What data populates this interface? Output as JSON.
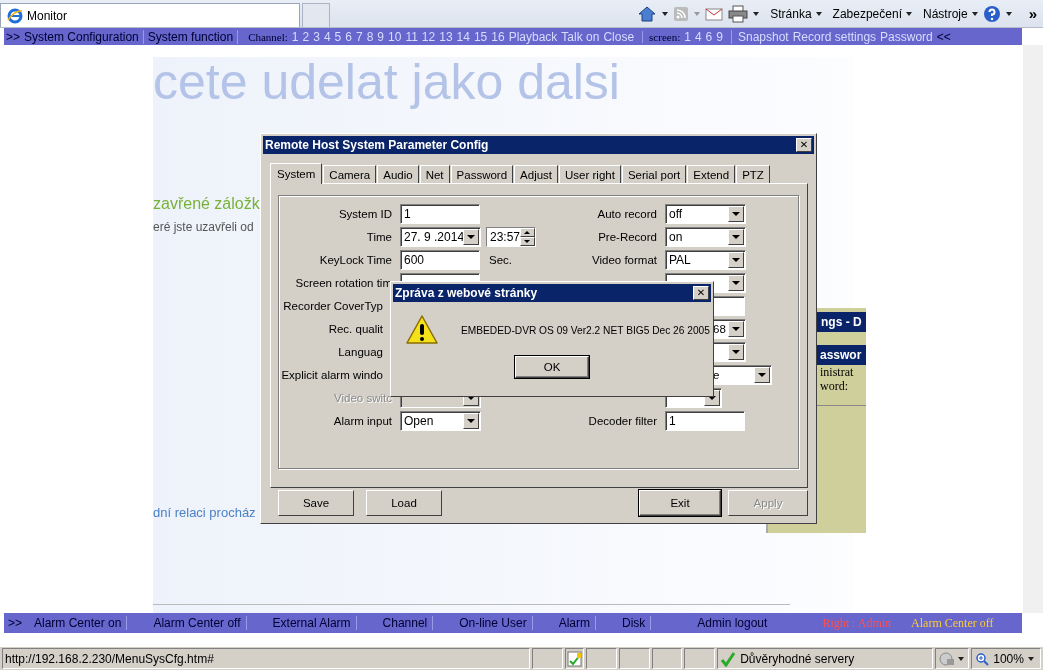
{
  "browser": {
    "tab_title": "Monitor",
    "menus": [
      "Stránka",
      "Zabezpečení",
      "Nástroje"
    ],
    "more": "»"
  },
  "nav": {
    "lead": ">>",
    "items": [
      "System Configuration",
      "System function"
    ],
    "channel_label": "Channel:",
    "channels": [
      "1",
      "2",
      "3",
      "4",
      "5",
      "6",
      "7",
      "8",
      "9",
      "10",
      "11",
      "12",
      "13",
      "14",
      "15",
      "16"
    ],
    "channel_actions": [
      "Playback",
      "Talk on",
      "Close"
    ],
    "screen_label": "screen:",
    "screens": [
      "1",
      "4",
      "6",
      "9"
    ],
    "links": [
      "Snapshot",
      "Record settings",
      "Password"
    ],
    "tail": "<<"
  },
  "background_page": {
    "heading": "cete udelat jako dalsi",
    "subheading": "zavřené záložk",
    "text": "eré jste uzavřeli od",
    "link": "dní relaci procház"
  },
  "back_window": {
    "title": "ngs - D",
    "section": "asswor",
    "lines": [
      "inistrat",
      "word:"
    ]
  },
  "dialog": {
    "title": "Remote Host System Parameter Config",
    "close": "✕",
    "tabs": [
      {
        "label": "System",
        "selected": true
      },
      {
        "label": "Camera",
        "selected": false
      },
      {
        "label": "Audio",
        "selected": false
      },
      {
        "label": "Net",
        "selected": false
      },
      {
        "label": "Password",
        "selected": false
      },
      {
        "label": "Adjust",
        "selected": false
      },
      {
        "label": "User right",
        "selected": false
      },
      {
        "label": "Serial port",
        "selected": false
      },
      {
        "label": "Extend",
        "selected": false
      },
      {
        "label": "PTZ",
        "selected": false
      }
    ],
    "left_fields": [
      {
        "label": "System ID",
        "kind": "text",
        "value": "1",
        "disabled": false
      },
      {
        "label": "Time",
        "kind": "datetime",
        "value": "27. 9 .2014",
        "time": "23:57",
        "disabled": false
      },
      {
        "label": "KeyLock Time",
        "kind": "text",
        "value": "600",
        "unit": "Sec.",
        "disabled": false
      },
      {
        "label": "Screen rotation tim",
        "kind": "text",
        "disabled": false
      },
      {
        "label": "Recorder CoverTyp",
        "kind": "none",
        "disabled": false
      },
      {
        "label": "Rec. qualit",
        "kind": "none",
        "disabled": false
      },
      {
        "label": "Languag",
        "kind": "none",
        "disabled": false
      },
      {
        "label": "Explicit alarm windo",
        "kind": "none",
        "disabled": false
      },
      {
        "label": "Video switc",
        "kind": "select",
        "disabled": true
      },
      {
        "label": "Alarm input",
        "kind": "select",
        "value": "Open",
        "disabled": false
      }
    ],
    "right_fields": [
      {
        "label": "Auto record",
        "kind": "select",
        "value": "off"
      },
      {
        "label": "Pre-Record",
        "kind": "select",
        "value": "on"
      },
      {
        "label": "Video format",
        "kind": "select",
        "value": "PAL"
      },
      {
        "kind": "select"
      },
      {
        "kind": "text"
      },
      {
        "kind": "select",
        "value": "68"
      },
      {
        "kind": "select"
      },
      {
        "kind": "wide-select",
        "value": "e"
      },
      {
        "kind": "narrow-select"
      },
      {
        "label": "Decoder filter",
        "kind": "text",
        "value": "1"
      }
    ],
    "buttons": [
      {
        "label": "Save",
        "default": false,
        "disabled": false
      },
      {
        "label": "Load",
        "default": false,
        "disabled": false
      },
      {
        "label": "Exit",
        "default": true,
        "disabled": false
      },
      {
        "label": "Apply",
        "default": false,
        "disabled": true
      }
    ]
  },
  "message_box": {
    "title": "Zpráva z webové stránky",
    "close": "✕",
    "message": "EMBEDED-DVR OS 09 Ver2.2 NET  BIG5 Dec 26 2005",
    "button": "OK"
  },
  "bottom_nav": {
    "lead": ">>",
    "items": [
      "Alarm Center on",
      "Alarm Center off",
      "External Alarm",
      "Channel",
      "On-line User",
      "Alarm",
      "Disk",
      "Admin logout"
    ],
    "right": "Right : Admin",
    "alarm": "Alarm Center off"
  },
  "status_bar": {
    "url": "http://192.168.2.230/MenuSysCfg.htm#",
    "zone": "Důvěryhodné servery",
    "zoom": "100%"
  }
}
